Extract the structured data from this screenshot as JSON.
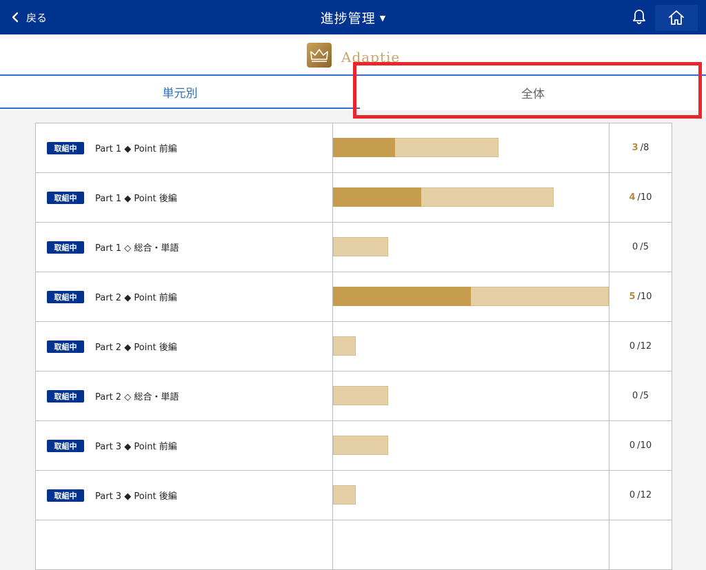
{
  "header": {
    "back_label": "戻る",
    "title": "進捗管理",
    "title_caret": "▼"
  },
  "brand": {
    "name": "Adaptie"
  },
  "tabs": [
    {
      "label": "単元別",
      "active": true
    },
    {
      "label": "全体",
      "active": false
    }
  ],
  "colors": {
    "header_bg": "#00328f",
    "accent_blue": "#2f6fc7",
    "bar_done": "#c69c4f",
    "bar_total": "#e4cfa6",
    "highlight": "#e8262c"
  },
  "rows": [
    {
      "status": "取組中",
      "name": "Part 1 ◆ Point 前編",
      "done": 3,
      "total": 8
    },
    {
      "status": "取組中",
      "name": "Part 1 ◆ Point 後編",
      "done": 4,
      "total": 10
    },
    {
      "status": "取組中",
      "name": "Part 1 ◇ 総合・単語",
      "done": 0,
      "total": 5
    },
    {
      "status": "取組中",
      "name": "Part 2 ◆ Point 前編",
      "done": 5,
      "total": 10
    },
    {
      "status": "取組中",
      "name": "Part 2 ◆ Point 後編",
      "done": 0,
      "total": 12
    },
    {
      "status": "取組中",
      "name": "Part 2 ◇ 総合・単語",
      "done": 0,
      "total": 5
    },
    {
      "status": "取組中",
      "name": "Part 3 ◆ Point 前編",
      "done": 0,
      "total": 10
    },
    {
      "status": "取組中",
      "name": "Part 3 ◆ Point 後編",
      "done": 0,
      "total": 12
    },
    {
      "status": "",
      "name": "",
      "done": null,
      "total": null
    }
  ]
}
